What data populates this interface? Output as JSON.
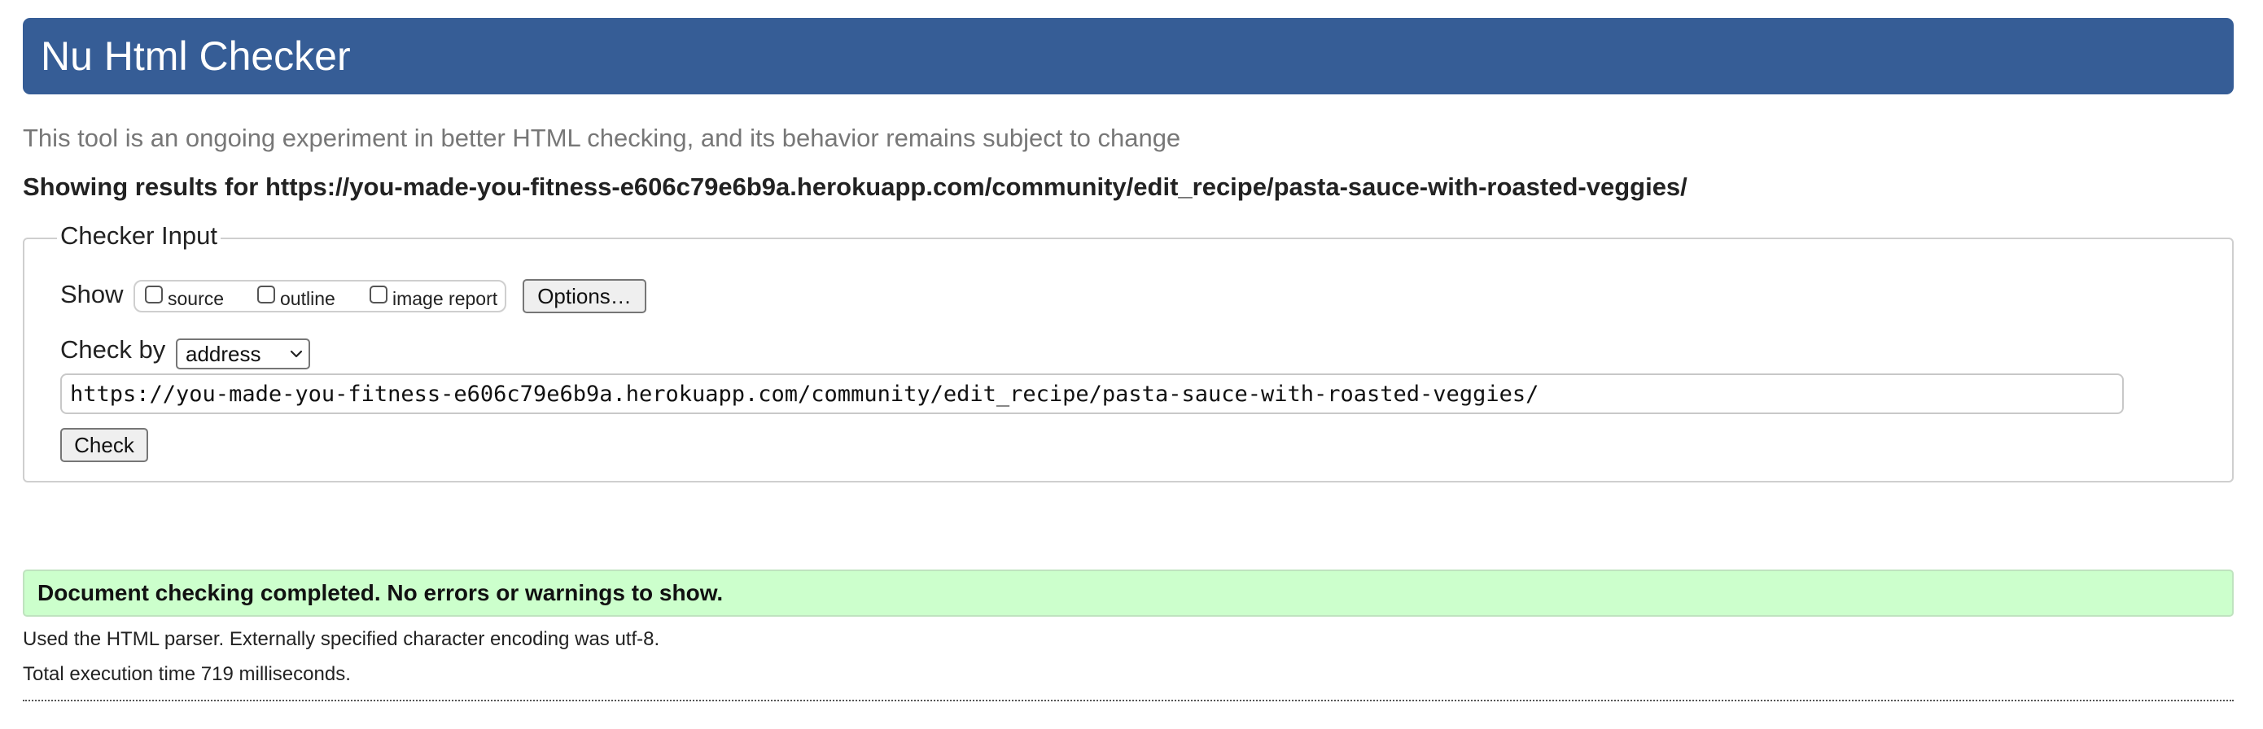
{
  "header": {
    "title": "Nu Html Checker"
  },
  "subtitle": "This tool is an ongoing experiment in better HTML checking, and its behavior remains subject to change",
  "results_for": "Showing results for https://you-made-you-fitness-e606c79e6b9a.herokuapp.com/community/edit_recipe/pasta-sauce-with-roasted-veggies/",
  "checker_input": {
    "legend": "Checker Input",
    "show_label": "Show",
    "show_options": [
      {
        "label": "source",
        "checked": false
      },
      {
        "label": "outline",
        "checked": false
      },
      {
        "label": "image report",
        "checked": false
      }
    ],
    "options_button": "Options…",
    "check_by_label": "Check by",
    "check_by_selected": "address",
    "address_value": "https://you-made-you-fitness-e606c79e6b9a.herokuapp.com/community/edit_recipe/pasta-sauce-with-roasted-veggies/",
    "check_button": "Check"
  },
  "result": {
    "message": "Document checking completed. No errors or warnings to show.",
    "parser_info": "Used the HTML parser. Externally specified character encoding was utf-8.",
    "execution_time": "Total execution time 719 milliseconds."
  },
  "colors": {
    "header_bg": "#365d96",
    "success_bg": "#ccffcc"
  },
  "icons": {
    "select_arrow": "chevron-down-icon"
  }
}
